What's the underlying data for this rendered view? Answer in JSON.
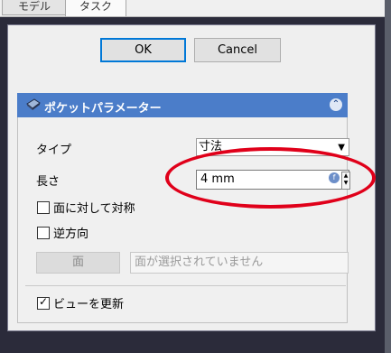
{
  "tabs": [
    {
      "label": "モデル"
    },
    {
      "label": "タスク"
    }
  ],
  "dialog": {
    "ok_label": "OK",
    "cancel_label": "Cancel"
  },
  "pocket": {
    "title": "ポケットパラメーター",
    "type_label": "タイプ",
    "type_value": "寸法",
    "length_label": "長さ",
    "length_value": "4 mm",
    "symmetric_label": "面に対して対称",
    "symmetric_checked": false,
    "reversed_label": "逆方向",
    "reversed_checked": false,
    "face_button_label": "面",
    "face_placeholder": "面が選択されていません",
    "update_view_label": "ビューを更新",
    "update_view_checked": true
  },
  "annotation": {
    "color": "#e0001a"
  },
  "colors": {
    "header_bg": "#4b7dc9",
    "panel_dark": "#2b2b3a",
    "ok_border": "#0078d7"
  }
}
